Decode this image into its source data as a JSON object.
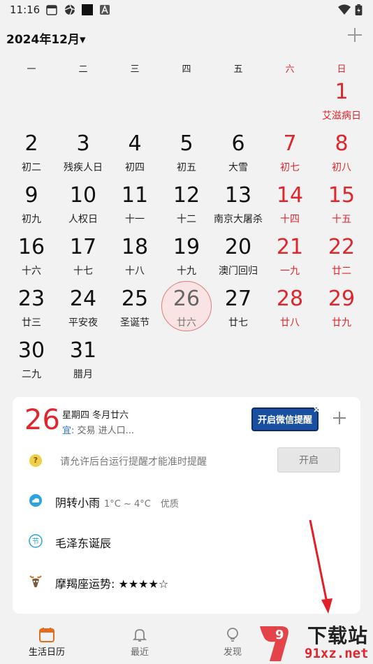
{
  "status_bar": {
    "time": "11:16"
  },
  "header": {
    "month_title": "2024年12月▾"
  },
  "weekdays": [
    "一",
    "二",
    "三",
    "四",
    "五",
    "六",
    "日"
  ],
  "days": [
    {
      "num": "1",
      "lunar": "艾滋病日"
    },
    {
      "num": "2",
      "lunar": "初二"
    },
    {
      "num": "3",
      "lunar": "残疾人日"
    },
    {
      "num": "4",
      "lunar": "初四"
    },
    {
      "num": "5",
      "lunar": "初五"
    },
    {
      "num": "6",
      "lunar": "大雪"
    },
    {
      "num": "7",
      "lunar": "初七"
    },
    {
      "num": "8",
      "lunar": "初八"
    },
    {
      "num": "9",
      "lunar": "初九"
    },
    {
      "num": "10",
      "lunar": "人权日"
    },
    {
      "num": "11",
      "lunar": "十一"
    },
    {
      "num": "12",
      "lunar": "十二"
    },
    {
      "num": "13",
      "lunar": "南京大屠杀"
    },
    {
      "num": "14",
      "lunar": "十四"
    },
    {
      "num": "15",
      "lunar": "十五"
    },
    {
      "num": "16",
      "lunar": "十六"
    },
    {
      "num": "17",
      "lunar": "十七"
    },
    {
      "num": "18",
      "lunar": "十八"
    },
    {
      "num": "19",
      "lunar": "十九"
    },
    {
      "num": "20",
      "lunar": "澳门回归"
    },
    {
      "num": "21",
      "lunar": "一九"
    },
    {
      "num": "22",
      "lunar": "廿二"
    },
    {
      "num": "23",
      "lunar": "廿三"
    },
    {
      "num": "24",
      "lunar": "平安夜"
    },
    {
      "num": "25",
      "lunar": "圣诞节"
    },
    {
      "num": "26",
      "lunar": "廿六"
    },
    {
      "num": "27",
      "lunar": "廿七"
    },
    {
      "num": "28",
      "lunar": "廿八"
    },
    {
      "num": "29",
      "lunar": "廿九"
    },
    {
      "num": "30",
      "lunar": "二九"
    },
    {
      "num": "31",
      "lunar": "腊月"
    }
  ],
  "detail_card": {
    "big_date": "26",
    "lunar_line": "星期四 冬月廿六",
    "yi_label": "宜:",
    "yi_text": "交易 进人口...",
    "wechat_button": "开启微信提醒",
    "permission_text": "请允许后台运行提醒才能准时提醒",
    "permission_button": "开启",
    "weather_text": "阴转小雨",
    "weather_temp": "1°C ~ 4°C",
    "weather_air": "优质",
    "event_text": "毛泽东诞辰",
    "horoscope_text": "摩羯座运势: ★★★★☆"
  },
  "nav": {
    "items": [
      {
        "label": "生活日历"
      },
      {
        "label": "最近"
      },
      {
        "label": "发现"
      }
    ]
  },
  "watermark": {
    "line1": "下载站",
    "line2": "91xz.net"
  },
  "colors": {
    "accent_red": "#e0262c",
    "wechat_blue": "#1a4fa0",
    "background": "#f2f2f2"
  }
}
